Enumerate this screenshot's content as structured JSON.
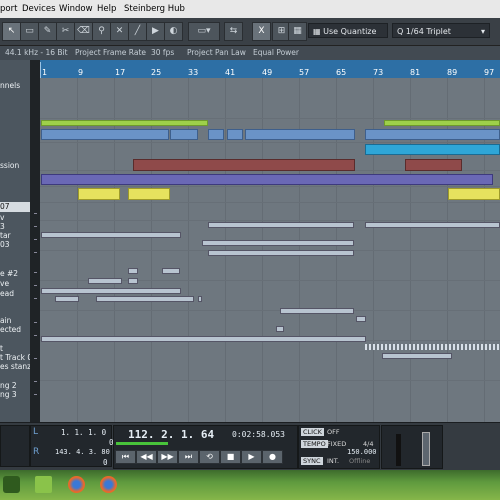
{
  "menu": [
    "port",
    "Devices",
    "Window",
    "Help",
    "Steinberg Hub"
  ],
  "toolbar": {
    "quantize_label": "Use Quantize",
    "grid_value": "1/64 Triplet",
    "snap_glyph": "X"
  },
  "infobar": [
    "44.1 kHz - 16 Bit",
    "Project Frame Rate",
    "30 fps",
    "Project Pan Law",
    "Equal Power"
  ],
  "ruler": [
    "1",
    "9",
    "17",
    "25",
    "33",
    "41",
    "49",
    "57",
    "65",
    "73",
    "81",
    "89",
    "97"
  ],
  "tracks": [
    {
      "label": "nnels"
    },
    {
      "label": "ssion"
    },
    {
      "label": "07",
      "highlight": true
    },
    {
      "label": "v"
    },
    {
      "label": "3"
    },
    {
      "label": "tar"
    },
    {
      "label": "03"
    },
    {
      "label": "e #2"
    },
    {
      "label": "ve"
    },
    {
      "label": "ead"
    },
    {
      "label": "ain"
    },
    {
      "label": "ected"
    },
    {
      "label": "t"
    },
    {
      "label": "t Track 0"
    },
    {
      "label": "es stanz"
    },
    {
      "label": "ng 2"
    },
    {
      "label": "ng 3"
    }
  ],
  "transport": {
    "left_pos": "1. 1. 1.  0",
    "left_pos2": "0",
    "right_pos": "143. 4. 3.  80",
    "right_pos2": "0",
    "primary": "112. 2. 1. 64",
    "secondary": "0:02:58.053",
    "click_label": "CLICK",
    "click_value": "OFF",
    "tempo_label": "TEMPO",
    "tempo_mode": "FIXED",
    "signature": "4/4",
    "tempo_value": "150.000",
    "sync_label": "SYNC",
    "sync_mode": "INT.",
    "sync_status": "Offline"
  },
  "colors": {
    "accent": "#2d6fa5",
    "green": "#9ed04a",
    "blue": "#6a93c7",
    "cyan": "#2fa6d7",
    "red": "#8f4a4a",
    "purple": "#6a68b5",
    "yellow": "#e6e25e",
    "gray": "#b8c4d0"
  }
}
